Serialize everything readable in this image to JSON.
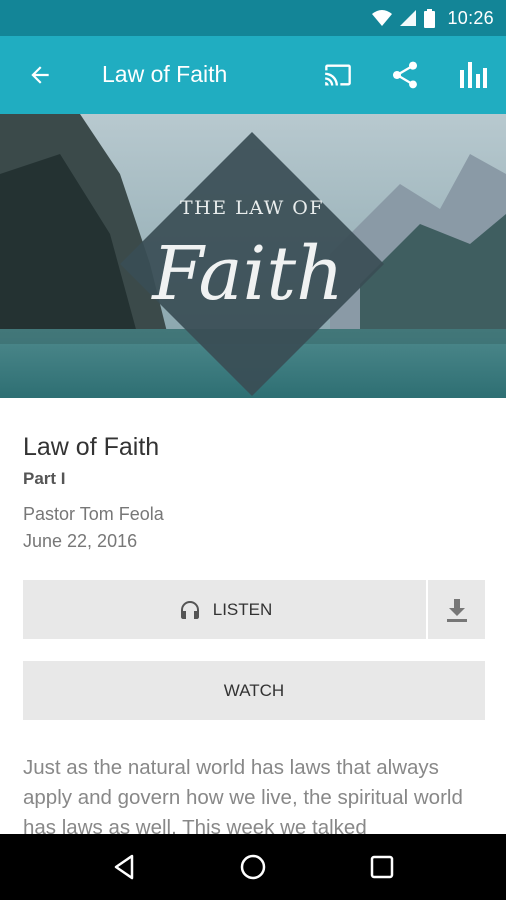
{
  "status": {
    "time": "10:26"
  },
  "appbar": {
    "title": "Law of Faith"
  },
  "hero": {
    "line1": "THE LAW OF",
    "line2": "Faith"
  },
  "sermon": {
    "title": "Law of Faith",
    "part": "Part I",
    "speaker": "Pastor Tom Feola",
    "date": "June 22, 2016"
  },
  "buttons": {
    "listen": "LISTEN",
    "watch": "WATCH"
  },
  "description": "Just as the natural world has laws that always apply and govern how we live, the spiritual world has laws as well. This week we talked",
  "colors": {
    "status_bar": "#138597",
    "app_bar": "#20adc1",
    "button_bg": "#e8e8e8"
  },
  "icons": {
    "status": [
      "wifi-icon",
      "signal-icon",
      "battery-icon"
    ],
    "appbar": [
      "back-arrow-icon",
      "cast-icon",
      "share-icon",
      "stats-icon"
    ],
    "nav": [
      "back-triangle-icon",
      "home-circle-icon",
      "recents-square-icon"
    ]
  }
}
